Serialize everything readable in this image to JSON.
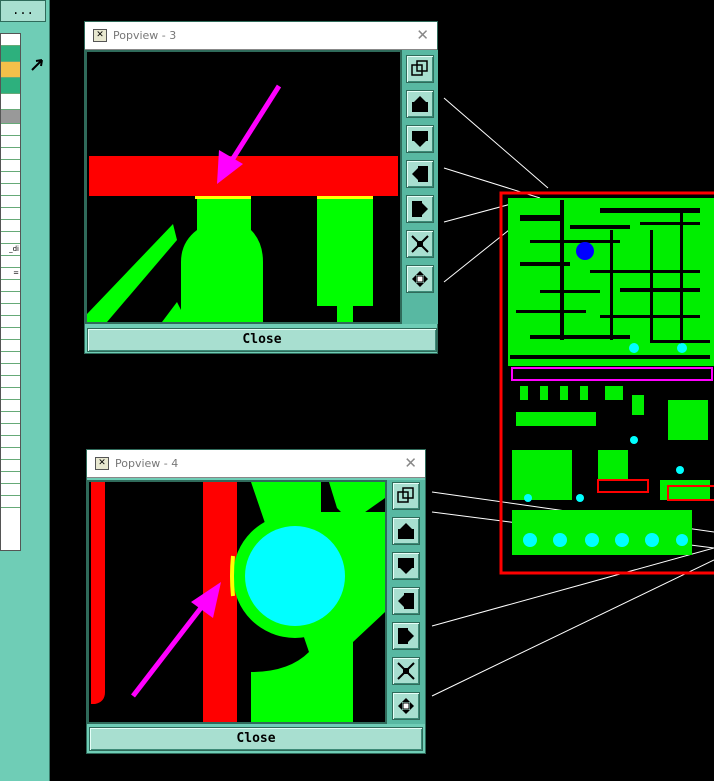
{
  "left_panel": {
    "top_button_label": "...",
    "row_marker_label": "_di",
    "row_marker_small": "="
  },
  "popview3": {
    "title": "Popview - 3",
    "close_symbol": "✕",
    "close_button_label": "Close"
  },
  "popview4": {
    "title": "Popview - 4",
    "close_symbol": "✕",
    "close_button_label": "Close"
  },
  "toolbar_icons": [
    "restore-view-icon",
    "move-up-icon",
    "move-down-icon",
    "move-left-icon",
    "move-right-icon",
    "zoom-in-icon",
    "zoom-out-icon"
  ],
  "colors": {
    "trace_green": "#00ff00",
    "net_red": "#ff0000",
    "pad_cyan": "#00ffff",
    "arrow_magenta": "#ff00ff",
    "highlight_yellow": "#ffff00",
    "panel_teal": "#6fcdb6"
  }
}
